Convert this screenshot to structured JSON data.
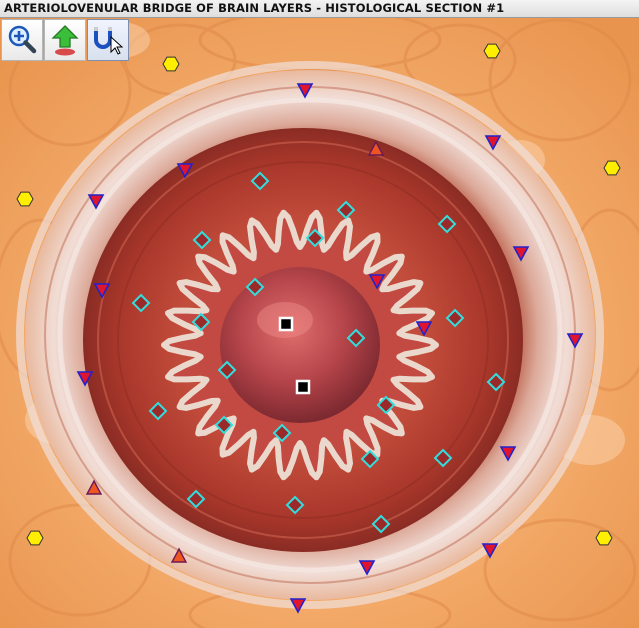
{
  "window": {
    "title": "ARTERIOLOVENULAR BRIDGE OF BRAIN LAYERS - HISTOLOGICAL SECTION #1"
  },
  "toolbar": {
    "buttons": [
      {
        "name": "zoom-in-button",
        "icon": "magnifier-plus-icon"
      },
      {
        "name": "upload-button",
        "icon": "green-up-arrow-icon"
      },
      {
        "name": "magnet-select-button",
        "icon": "magnet-cursor-icon"
      }
    ]
  },
  "image": {
    "subject": "histological-section-arteriole",
    "palette": {
      "tissue_outer": "#f3a968",
      "ring_pale": "#efd6cf",
      "wall_red": "#a8362a",
      "lumen": "#b5454a"
    }
  },
  "markers": {
    "colors": {
      "hexagon": "#ffee00",
      "triangle_down": "#2222cc",
      "triangle_up": "#cc3322",
      "diamond": "#33dddd",
      "square": "#000000"
    }
  }
}
